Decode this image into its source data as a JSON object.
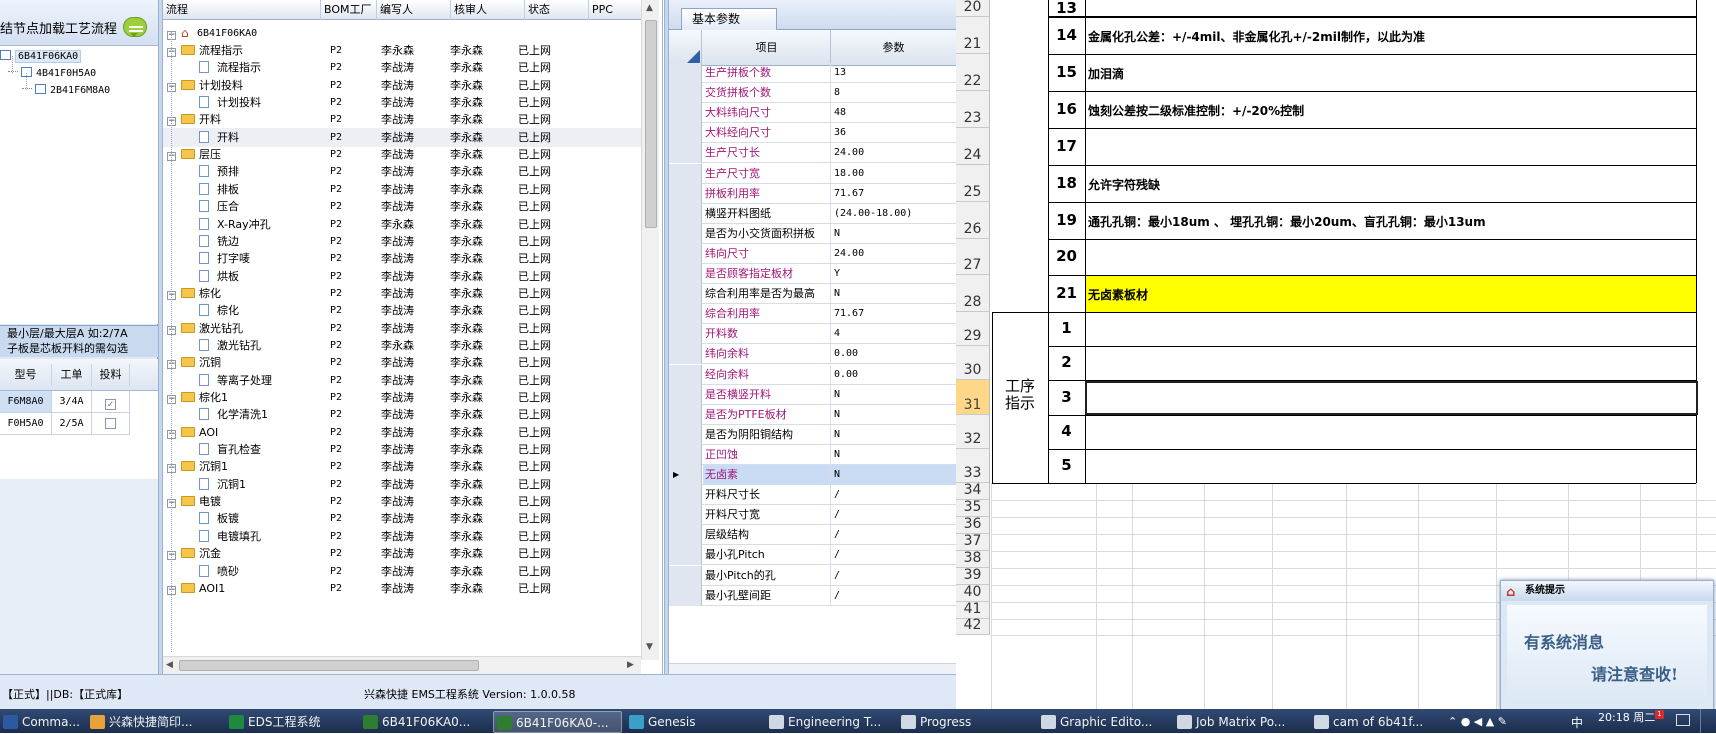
{
  "left_panel": {
    "header_title": "结节点加载工艺流程",
    "tree": [
      {
        "label": "6B41F06KA0"
      },
      {
        "label": "4B41F0H5A0"
      },
      {
        "label": "2B41F6M8A0"
      }
    ],
    "notice_line1": "最小层/最大层A 如:2/7A",
    "notice_line2": "子板是芯板开料的需勾选",
    "grid_headers": [
      "型号",
      "工单",
      "投料"
    ],
    "grid_rows": [
      {
        "model": "F6M8A0",
        "order": "3/4A",
        "checked": true
      },
      {
        "model": "F0H5A0",
        "order": "2/5A",
        "checked": false
      }
    ]
  },
  "process_grid": {
    "headers": [
      "流程",
      "BOM工厂",
      "编写人",
      "核审人",
      "状态",
      "PPC"
    ],
    "root": "6B41F06KA0",
    "rows": [
      {
        "name": "流程指示",
        "kind": "group",
        "bom": "P2",
        "writer": "李永森",
        "reviewer": "李永森",
        "status": "已上网"
      },
      {
        "name": "流程指示",
        "kind": "item",
        "bom": "P2",
        "writer": "李战涛",
        "reviewer": "李永森",
        "status": "已上网"
      },
      {
        "name": "计划投料",
        "kind": "group",
        "bom": "P2",
        "writer": "李战涛",
        "reviewer": "李永森",
        "status": "已上网"
      },
      {
        "name": "计划投料",
        "kind": "item",
        "bom": "P2",
        "writer": "李战涛",
        "reviewer": "李永森",
        "status": "已上网"
      },
      {
        "name": "开料",
        "kind": "group",
        "bom": "P2",
        "writer": "李战涛",
        "reviewer": "李永森",
        "status": "已上网"
      },
      {
        "name": "开料",
        "kind": "item",
        "bom": "P2",
        "writer": "李战涛",
        "reviewer": "李永森",
        "status": "已上网"
      },
      {
        "name": "层压",
        "kind": "group",
        "bom": "P2",
        "writer": "李战涛",
        "reviewer": "李永森",
        "status": "已上网"
      },
      {
        "name": "预排",
        "kind": "item",
        "bom": "P2",
        "writer": "李战涛",
        "reviewer": "李永森",
        "status": "已上网"
      },
      {
        "name": "排板",
        "kind": "item",
        "bom": "P2",
        "writer": "李战涛",
        "reviewer": "李永森",
        "status": "已上网"
      },
      {
        "name": "压合",
        "kind": "item",
        "bom": "P2",
        "writer": "李战涛",
        "reviewer": "李永森",
        "status": "已上网"
      },
      {
        "name": "X-Ray冲孔",
        "kind": "item",
        "bom": "P2",
        "writer": "李永森",
        "reviewer": "李永森",
        "status": "已上网"
      },
      {
        "name": "铣边",
        "kind": "item",
        "bom": "P2",
        "writer": "李战涛",
        "reviewer": "李永森",
        "status": "已上网"
      },
      {
        "name": "打字唛",
        "kind": "item",
        "bom": "P2",
        "writer": "李战涛",
        "reviewer": "李永森",
        "status": "已上网"
      },
      {
        "name": "烘板",
        "kind": "item",
        "bom": "P2",
        "writer": "李战涛",
        "reviewer": "李永森",
        "status": "已上网"
      },
      {
        "name": "棕化",
        "kind": "group",
        "bom": "P2",
        "writer": "李战涛",
        "reviewer": "李永森",
        "status": "已上网"
      },
      {
        "name": "棕化",
        "kind": "item",
        "bom": "P2",
        "writer": "李战涛",
        "reviewer": "李永森",
        "status": "已上网"
      },
      {
        "name": "激光钻孔",
        "kind": "group",
        "bom": "P2",
        "writer": "李战涛",
        "reviewer": "李永森",
        "status": "已上网"
      },
      {
        "name": "激光钻孔",
        "kind": "item",
        "bom": "P2",
        "writer": "李永森",
        "reviewer": "李永森",
        "status": "已上网"
      },
      {
        "name": "沉铜",
        "kind": "group",
        "bom": "P2",
        "writer": "李战涛",
        "reviewer": "李永森",
        "status": "已上网"
      },
      {
        "name": "等离子处理",
        "kind": "item",
        "bom": "P2",
        "writer": "李战涛",
        "reviewer": "李永森",
        "status": "已上网"
      },
      {
        "name": "棕化1",
        "kind": "group",
        "bom": "P2",
        "writer": "李战涛",
        "reviewer": "李永森",
        "status": "已上网"
      },
      {
        "name": "化学清洗1",
        "kind": "item",
        "bom": "P2",
        "writer": "李战涛",
        "reviewer": "李永森",
        "status": "已上网"
      },
      {
        "name": "AOI",
        "kind": "group",
        "bom": "P2",
        "writer": "李战涛",
        "reviewer": "李永森",
        "status": "已上网"
      },
      {
        "name": "盲孔检查",
        "kind": "item",
        "bom": "P2",
        "writer": "李战涛",
        "reviewer": "李永森",
        "status": "已上网"
      },
      {
        "name": "沉铜1",
        "kind": "group",
        "bom": "P2",
        "writer": "李战涛",
        "reviewer": "李永森",
        "status": "已上网"
      },
      {
        "name": "沉铜1",
        "kind": "item",
        "bom": "P2",
        "writer": "李战涛",
        "reviewer": "李永森",
        "status": "已上网"
      },
      {
        "name": "电镀",
        "kind": "group",
        "bom": "P2",
        "writer": "李战涛",
        "reviewer": "李永森",
        "status": "已上网"
      },
      {
        "name": "板镀",
        "kind": "item",
        "bom": "P2",
        "writer": "李战涛",
        "reviewer": "李永森",
        "status": "已上网"
      },
      {
        "name": "电镀填孔",
        "kind": "item",
        "bom": "P2",
        "writer": "李战涛",
        "reviewer": "李永森",
        "status": "已上网"
      },
      {
        "name": "沉金",
        "kind": "group",
        "bom": "P2",
        "writer": "李战涛",
        "reviewer": "李永森",
        "status": "已上网"
      },
      {
        "name": "喷砂",
        "kind": "item",
        "bom": "P2",
        "writer": "李战涛",
        "reviewer": "李永森",
        "status": "已上网"
      },
      {
        "name": "AOI1",
        "kind": "group",
        "bom": "P2",
        "writer": "李战涛",
        "reviewer": "李永森",
        "status": "已上网"
      }
    ]
  },
  "params_panel": {
    "tab": "基本参数",
    "headers": [
      "项目",
      "参数"
    ],
    "rows": [
      {
        "label": "生产拼板个数",
        "value": "13",
        "accent": true
      },
      {
        "label": "交货拼板个数",
        "value": "8",
        "accent": true
      },
      {
        "label": "大料纬向尺寸",
        "value": "48",
        "accent": true
      },
      {
        "label": "大料经向尺寸",
        "value": "36",
        "accent": true
      },
      {
        "label": "生产尺寸长",
        "value": "24.00",
        "accent": true
      },
      {
        "label": "生产尺寸宽",
        "value": "18.00",
        "accent": true
      },
      {
        "label": "拼板利用率",
        "value": "71.67",
        "accent": true
      },
      {
        "label": "横竖开料图纸",
        "value": "(24.00-18.00)",
        "accent": false
      },
      {
        "label": "是否为小交货面积拼板",
        "value": "N",
        "accent": false
      },
      {
        "label": "纬向尺寸",
        "value": "24.00",
        "accent": true
      },
      {
        "label": "是否顾客指定板材",
        "value": "Y",
        "accent": true
      },
      {
        "label": "综合利用率是否为最高",
        "value": "N",
        "accent": false
      },
      {
        "label": "综合利用率",
        "value": "71.67",
        "accent": true
      },
      {
        "label": "开料数",
        "value": "4",
        "accent": true
      },
      {
        "label": "纬向余料",
        "value": "0.00",
        "accent": true
      },
      {
        "label": "经向余料",
        "value": "0.00",
        "accent": true
      },
      {
        "label": "是否横竖开料",
        "value": "N",
        "accent": true
      },
      {
        "label": "是否为PTFE板材",
        "value": "N",
        "accent": true
      },
      {
        "label": "是否为阴阳铜结构",
        "value": "N",
        "accent": false
      },
      {
        "label": "正凹蚀",
        "value": "N",
        "accent": true
      },
      {
        "label": "无卤素",
        "value": "N",
        "accent": true
      },
      {
        "label": "开料尺寸长",
        "value": "/",
        "accent": false
      },
      {
        "label": "开料尺寸宽",
        "value": "/",
        "accent": false
      },
      {
        "label": "层级结构",
        "value": "/",
        "accent": false
      },
      {
        "label": "最小孔Pitch",
        "value": "/",
        "accent": false
      },
      {
        "label": "最小Pitch的孔",
        "value": "/",
        "accent": false
      },
      {
        "label": "最小孔壁间距",
        "value": "/",
        "accent": false
      }
    ]
  },
  "sheet": {
    "row_numbers": [
      "20",
      "21",
      "22",
      "23",
      "24",
      "25",
      "26",
      "27",
      "28",
      "29",
      "30",
      "31",
      "32",
      "33",
      "34",
      "35",
      "36",
      "37",
      "38",
      "39",
      "40",
      "41",
      "42"
    ],
    "spec_rows": [
      {
        "num": "13",
        "text": ""
      },
      {
        "num": "14",
        "text": "金属化孔公差：+/-4mil、非金属化孔+/-2mil制作，以此为准"
      },
      {
        "num": "15",
        "text": "加泪滴"
      },
      {
        "num": "16",
        "text": "蚀刻公差按二级标准控制：+/-20%控制"
      },
      {
        "num": "17",
        "text": ""
      },
      {
        "num": "18",
        "text": "允许字符残缺"
      },
      {
        "num": "19",
        "text": "通孔孔铜：最小18um 、 埋孔孔铜：最小20um、盲孔孔铜：最小13um"
      },
      {
        "num": "20",
        "text": ""
      },
      {
        "num": "21",
        "text": "无卤素板材"
      }
    ],
    "process_label": "工序指示",
    "process_rows": [
      "1",
      "2",
      "3",
      "4",
      "5"
    ],
    "highlight_color": "#ffff00"
  },
  "popup": {
    "title": "系统提示",
    "line1": "有系统消息",
    "line2": "请注意查收!"
  },
  "status_bar": {
    "left": "【正式】||DB:【正式库】",
    "center": "兴森快捷 EMS工程系统 Version: 1.0.0.58"
  },
  "taskbar": {
    "items": [
      "Comma...",
      "兴森快捷简印...",
      "EDS工程系统",
      "6B41F06KA0...",
      "6B41F06KA0-...",
      "Genesis",
      "Engineering T...",
      "Progress",
      "Graphic Edito...",
      "Job Matrix Po...",
      "cam of 6b41f..."
    ],
    "ime": "中",
    "time": "20:18 周二",
    "notify_count": "1"
  }
}
